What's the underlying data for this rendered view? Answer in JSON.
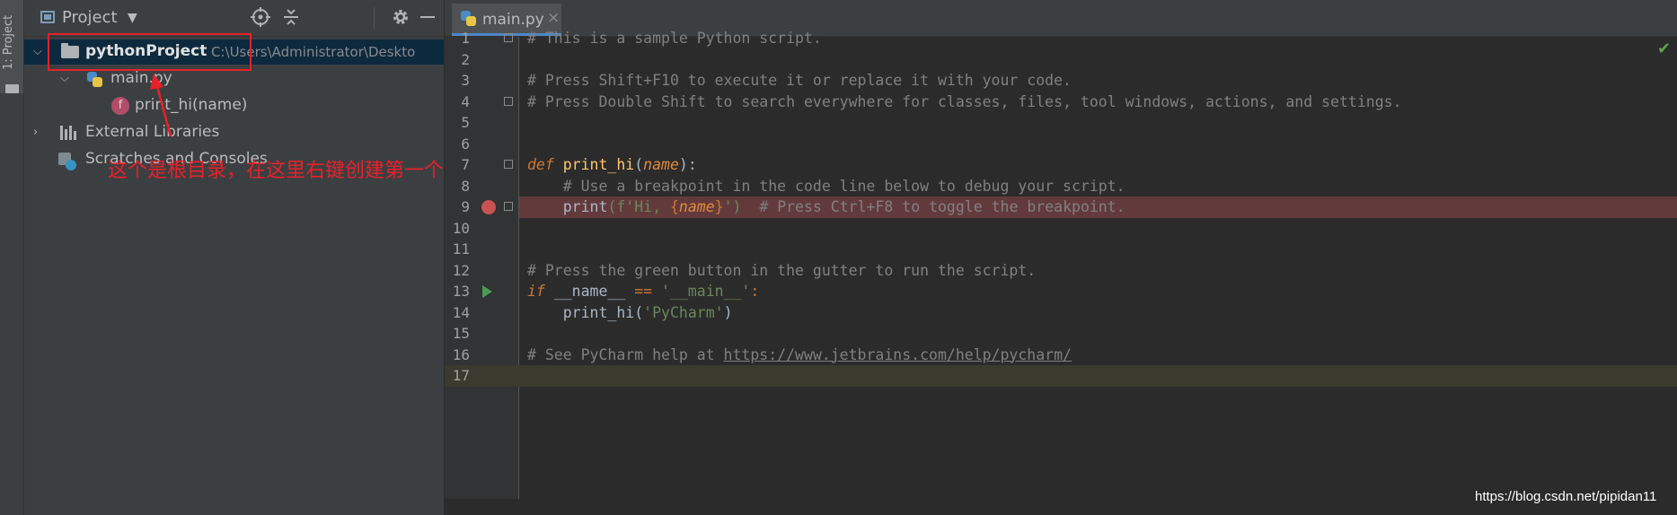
{
  "tool_window": {
    "strip_label": "1: Project",
    "title": "Project",
    "dropdown_icon": "chevron-down-icon",
    "buttons": [
      "locate-icon",
      "collapse-all-icon",
      "gear-icon",
      "minimize-icon"
    ]
  },
  "tree": {
    "root_name": "pythonProject",
    "root_path": "C:\\Users\\Administrator\\Deskto",
    "file_name": "main.py",
    "function_name": "print_hi(name)",
    "function_badge": "f",
    "external_libraries": "External Libraries",
    "scratches": "Scratches and Consoles"
  },
  "annotation": {
    "text": "这个是根目录，在这里右键创建第一个文件",
    "color": "#E8202A"
  },
  "editor": {
    "tab_label": "main.py",
    "tab_close": "×",
    "status_check": "✔",
    "lines": [
      {
        "n": "1",
        "segs": [
          {
            "t": "# This is a sample Python script.",
            "c": "c-cmt"
          }
        ]
      },
      {
        "n": "2",
        "segs": []
      },
      {
        "n": "3",
        "segs": [
          {
            "t": "# Press Shift+F10 to execute it or replace it with your code.",
            "c": "c-cmt"
          }
        ]
      },
      {
        "n": "4",
        "segs": [
          {
            "t": "# Press Double Shift to search everywhere for classes, files, tool windows, actions, and settings.",
            "c": "c-cmt"
          }
        ]
      },
      {
        "n": "5",
        "segs": []
      },
      {
        "n": "6",
        "segs": []
      },
      {
        "n": "7",
        "segs": [
          {
            "t": "def ",
            "c": "c-kwi"
          },
          {
            "t": "print_hi",
            "c": "c-fn"
          },
          {
            "t": "(",
            "c": "c-def"
          },
          {
            "t": "name",
            "c": "c-param"
          },
          {
            "t": "):",
            "c": "c-def"
          }
        ]
      },
      {
        "n": "8",
        "segs": [
          {
            "t": "    # Use a breakpoint in the code line below to debug your script.",
            "c": "c-cmt"
          }
        ]
      },
      {
        "n": "9",
        "segs": [
          {
            "t": "    print",
            "c": "c-call"
          },
          {
            "t": "(f'Hi, ",
            "c": "c-str"
          },
          {
            "t": "{",
            "c": "c-kw"
          },
          {
            "t": "name",
            "c": "c-param"
          },
          {
            "t": "}",
            "c": "c-kw"
          },
          {
            "t": "')",
            "c": "c-str"
          },
          {
            "t": "  # Press Ctrl+F8 to toggle the breakpoint.",
            "c": "c-cmt"
          }
        ]
      },
      {
        "n": "10",
        "segs": []
      },
      {
        "n": "11",
        "segs": []
      },
      {
        "n": "12",
        "segs": [
          {
            "t": "# Press the green button in the gutter to run the script.",
            "c": "c-cmt"
          }
        ]
      },
      {
        "n": "13",
        "segs": [
          {
            "t": "if ",
            "c": "c-kwi"
          },
          {
            "t": "__name__ ",
            "c": "c-strong"
          },
          {
            "t": "== ",
            "c": "c-kw"
          },
          {
            "t": "'__main__'",
            "c": "c-str"
          },
          {
            "t": ":",
            "c": "c-kw"
          }
        ]
      },
      {
        "n": "14",
        "segs": [
          {
            "t": "    print_hi",
            "c": "c-call"
          },
          {
            "t": "(",
            "c": "c-def"
          },
          {
            "t": "'PyCharm'",
            "c": "c-str"
          },
          {
            "t": ")",
            "c": "c-def"
          }
        ]
      },
      {
        "n": "15",
        "segs": []
      },
      {
        "n": "16",
        "segs": [
          {
            "t": "# See PyCharm help at ",
            "c": "c-cmt"
          },
          {
            "t": "https://www.jetbrains.com/help/pycharm/",
            "c": "c-link"
          }
        ]
      },
      {
        "n": "17",
        "segs": []
      }
    ],
    "breakpoint_line": "9",
    "run_line": "13",
    "current_line": "17"
  },
  "watermark": "https://blog.csdn.net/pipidan11"
}
